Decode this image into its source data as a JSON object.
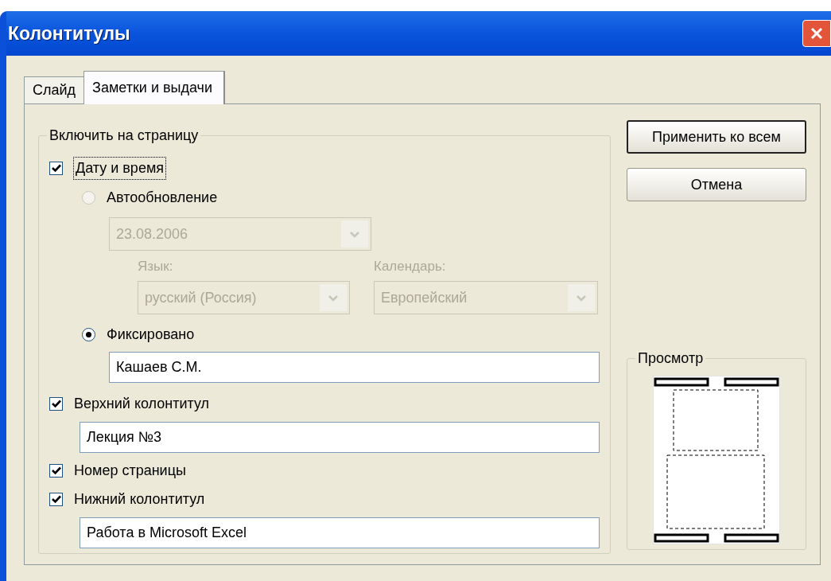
{
  "window": {
    "title": "Колонтитулы"
  },
  "tabs": [
    {
      "label": "Слайд",
      "selected": false
    },
    {
      "label": "Заметки и выдачи",
      "selected": true
    }
  ],
  "include_group": {
    "title": "Включить на страницу",
    "date_time": {
      "label": "Дату и время",
      "checked": true,
      "focused": true
    },
    "auto_update": {
      "label": "Автообновление",
      "selected": false,
      "disabled": true,
      "date": "23.08.2006",
      "language_label": "Язык:",
      "language": "русский (Россия)",
      "calendar_label": "Календарь:",
      "calendar": "Европейский"
    },
    "fixed": {
      "label": "Фиксировано",
      "selected": true,
      "value": "Кашаев С.М."
    },
    "header": {
      "label": "Верхний колонтитул",
      "checked": true,
      "value": "Лекция №3"
    },
    "page_number": {
      "label": "Номер страницы",
      "checked": true
    },
    "footer": {
      "label": "Нижний колонтитул",
      "checked": true,
      "value": "Работа в Microsoft Excel"
    }
  },
  "buttons": [
    {
      "label": "Применить ко всем",
      "default": true
    },
    {
      "label": "Отмена",
      "default": false
    }
  ],
  "preview": {
    "title": "Просмотр"
  }
}
